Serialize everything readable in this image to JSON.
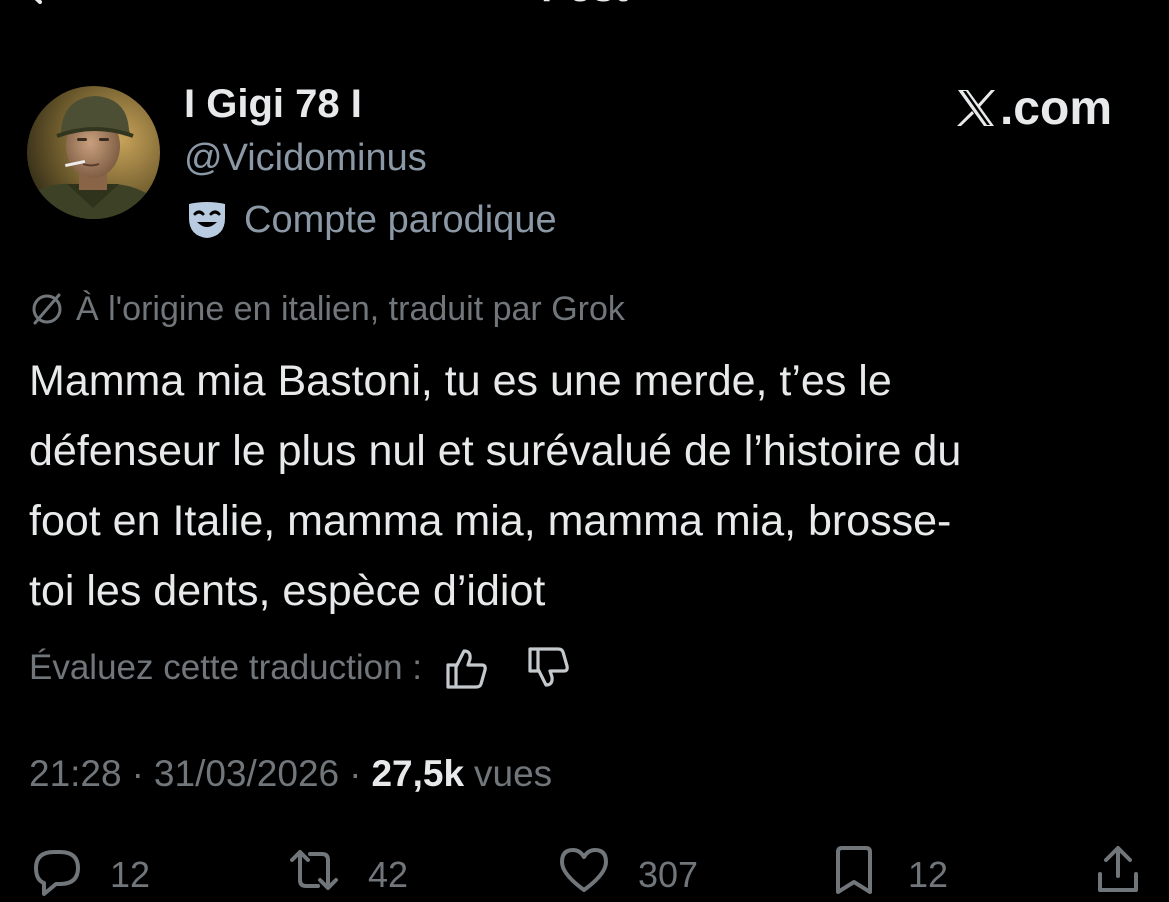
{
  "header": {
    "title": "Post"
  },
  "author": {
    "display_name": "I Gigi 78 I",
    "handle": "@Vicidominus",
    "parody_label": "Compte parodique"
  },
  "watermark": {
    "text": ".com"
  },
  "translation": {
    "notice": "À l'origine en italien, traduit par Grok",
    "rate_label": "Évaluez cette traduction :"
  },
  "tweet": {
    "lines": [
      "Mamma mia Bastoni, tu es une merde, t’es le",
      "défenseur le plus nul et surévalué de l’histoire du",
      "foot en Italie, mamma mia, mamma mia, brosse-",
      "toi les dents, espèce d’idiot"
    ]
  },
  "meta": {
    "time": "21:28",
    "date": "31/03/2026",
    "separator": "·",
    "views_count": "27,5k",
    "views_label": "vues"
  },
  "actions": {
    "replies": "12",
    "reposts": "42",
    "likes": "307",
    "bookmarks": "12"
  },
  "icons": {
    "back": "arrow-left-icon",
    "parody": "theater-mask-icon",
    "translate": "globe-icon",
    "like": "thumbs-up-icon",
    "dislike": "thumbs-down-icon",
    "reply": "reply-icon",
    "repost": "repost-icon",
    "heart": "heart-icon",
    "bookmark": "bookmark-icon",
    "share": "share-icon"
  },
  "colors": {
    "background": "#000000",
    "text_primary": "#e7e9ea",
    "text_secondary": "#71767b",
    "handle": "#8b98a5",
    "parody_icon": "#b9cbe0"
  }
}
